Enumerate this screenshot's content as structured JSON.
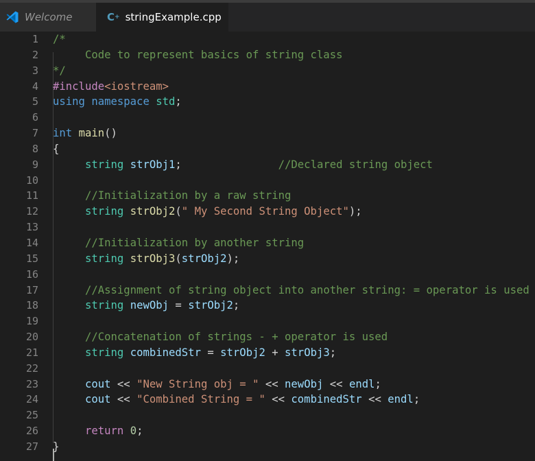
{
  "tabs": [
    {
      "label": "Welcome",
      "active": false,
      "icon": "vscode-logo-icon"
    },
    {
      "label": "stringExample.cpp",
      "active": true,
      "icon": "cpp-file-icon",
      "modified": true
    }
  ],
  "colors": {
    "background": "#1e1e1e",
    "comment": "#6a9955",
    "keyword": "#569cd6",
    "preprocessor": "#c586c0",
    "string": "#ce9178",
    "type": "#4ec9b0",
    "variable": "#9cdcfe",
    "function": "#dcdcaa",
    "number": "#b5cea8",
    "line_number": "#858585"
  },
  "code_lines": [
    [
      [
        "comment",
        "/*"
      ]
    ],
    [
      [
        "comment",
        "     Code to represent basics of string class"
      ]
    ],
    [
      [
        "comment",
        "*/"
      ]
    ],
    [
      [
        "pre",
        "#include"
      ],
      [
        "str",
        "<iostream>"
      ]
    ],
    [
      [
        "kw",
        "using"
      ],
      [
        "plain",
        " "
      ],
      [
        "kw",
        "namespace"
      ],
      [
        "plain",
        " "
      ],
      [
        "type",
        "std"
      ],
      [
        "plain",
        ";"
      ]
    ],
    [],
    [
      [
        "kw",
        "int"
      ],
      [
        "plain",
        " "
      ],
      [
        "fn",
        "main"
      ],
      [
        "plain",
        "()"
      ]
    ],
    [
      [
        "plain",
        "{"
      ]
    ],
    [
      [
        "plain",
        "     "
      ],
      [
        "type",
        "string"
      ],
      [
        "plain",
        " "
      ],
      [
        "var",
        "strObj1"
      ],
      [
        "plain",
        ";               "
      ],
      [
        "comment",
        "//Declared string object"
      ]
    ],
    [],
    [
      [
        "plain",
        "     "
      ],
      [
        "comment",
        "//Initialization by a raw string"
      ]
    ],
    [
      [
        "plain",
        "     "
      ],
      [
        "type",
        "string"
      ],
      [
        "plain",
        " "
      ],
      [
        "fn",
        "strObj2"
      ],
      [
        "plain",
        "("
      ],
      [
        "str",
        "\" My Second String Object\""
      ],
      [
        "plain",
        ");"
      ]
    ],
    [],
    [
      [
        "plain",
        "     "
      ],
      [
        "comment",
        "//Initialization by another string"
      ]
    ],
    [
      [
        "plain",
        "     "
      ],
      [
        "type",
        "string"
      ],
      [
        "plain",
        " "
      ],
      [
        "fn",
        "strObj3"
      ],
      [
        "plain",
        "("
      ],
      [
        "var",
        "strObj2"
      ],
      [
        "plain",
        ");"
      ]
    ],
    [],
    [
      [
        "plain",
        "     "
      ],
      [
        "comment",
        "//Assignment of string object into another string: = operator is used"
      ]
    ],
    [
      [
        "plain",
        "     "
      ],
      [
        "type",
        "string"
      ],
      [
        "plain",
        " "
      ],
      [
        "var",
        "newObj"
      ],
      [
        "plain",
        " = "
      ],
      [
        "var",
        "strObj2"
      ],
      [
        "plain",
        ";"
      ]
    ],
    [],
    [
      [
        "plain",
        "     "
      ],
      [
        "comment",
        "//Concatenation of strings - + operator is used"
      ]
    ],
    [
      [
        "plain",
        "     "
      ],
      [
        "type",
        "string"
      ],
      [
        "plain",
        " "
      ],
      [
        "var",
        "combinedStr"
      ],
      [
        "plain",
        " = "
      ],
      [
        "var",
        "strObj2"
      ],
      [
        "plain",
        " + "
      ],
      [
        "var",
        "strObj3"
      ],
      [
        "plain",
        ";"
      ]
    ],
    [],
    [
      [
        "plain",
        "     "
      ],
      [
        "var",
        "cout"
      ],
      [
        "plain",
        " << "
      ],
      [
        "str",
        "\"New String obj = \""
      ],
      [
        "plain",
        " << "
      ],
      [
        "var",
        "newObj"
      ],
      [
        "plain",
        " << "
      ],
      [
        "var",
        "endl"
      ],
      [
        "plain",
        ";"
      ]
    ],
    [
      [
        "plain",
        "     "
      ],
      [
        "var",
        "cout"
      ],
      [
        "plain",
        " << "
      ],
      [
        "str",
        "\"Combined String = \""
      ],
      [
        "plain",
        " << "
      ],
      [
        "var",
        "combinedStr"
      ],
      [
        "plain",
        " << "
      ],
      [
        "var",
        "endl"
      ],
      [
        "plain",
        ";"
      ]
    ],
    [],
    [
      [
        "plain",
        "     "
      ],
      [
        "pre",
        "return"
      ],
      [
        "plain",
        " "
      ],
      [
        "num",
        "0"
      ],
      [
        "plain",
        ";"
      ]
    ],
    [
      [
        "plain",
        "}"
      ]
    ]
  ]
}
